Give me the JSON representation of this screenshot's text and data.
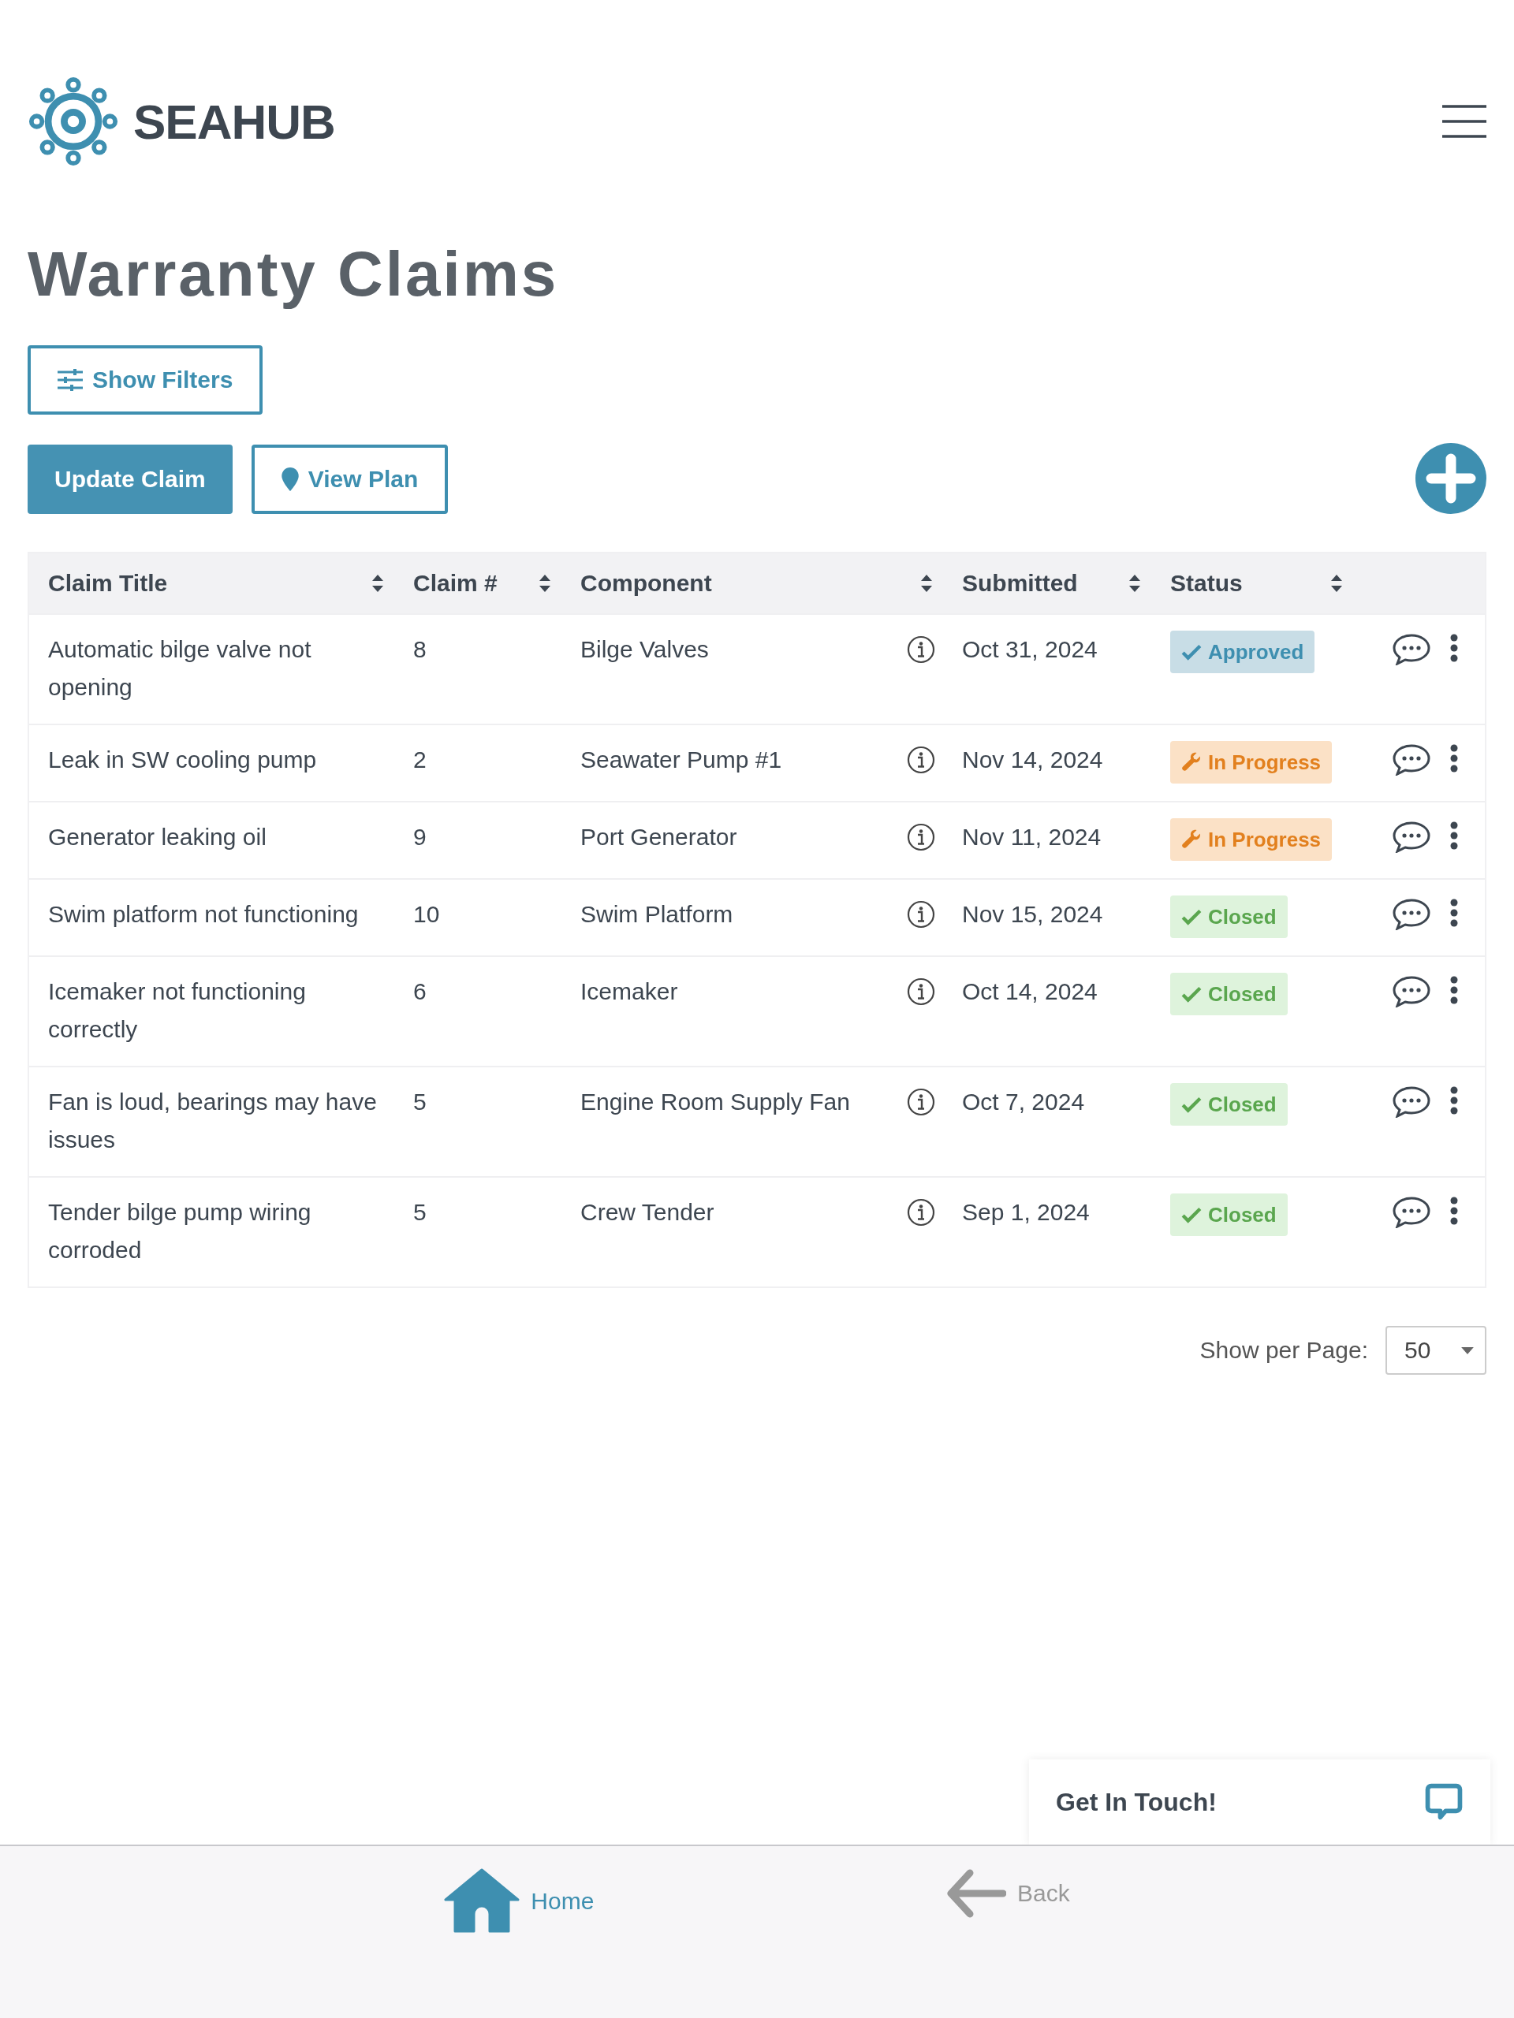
{
  "brand": {
    "name": "SEAHUB"
  },
  "page_title": "Warranty Claims",
  "filters_button": "Show Filters",
  "actions": [
    {
      "label": "Update Claim",
      "kind": "primary"
    },
    {
      "label": "View Plan",
      "kind": "outline"
    }
  ],
  "table": {
    "columns": [
      {
        "label": "Claim Title",
        "sortable": true
      },
      {
        "label": "Claim #",
        "sortable": true
      },
      {
        "label": "Component",
        "sortable": true
      },
      {
        "label": "Submitted",
        "sortable": true
      },
      {
        "label": "Status",
        "sortable": true
      }
    ],
    "rows": [
      {
        "title": "Automatic bilge valve not opening",
        "number": "8",
        "component": "Bilge Valves",
        "submitted": "Oct 31, 2024",
        "status": {
          "label": "Approved",
          "kind": "approved"
        }
      },
      {
        "title": "Leak in SW cooling pump",
        "number": "2",
        "component": "Seawater Pump #1",
        "submitted": "Nov 14, 2024",
        "status": {
          "label": "In Progress",
          "kind": "in_progress"
        }
      },
      {
        "title": "Generator leaking oil",
        "number": "9",
        "component": "Port Generator",
        "submitted": "Nov 11, 2024",
        "status": {
          "label": "In Progress",
          "kind": "in_progress"
        }
      },
      {
        "title": "Swim platform not functioning",
        "number": "10",
        "component": "Swim Platform",
        "submitted": "Nov 15, 2024",
        "status": {
          "label": "Closed",
          "kind": "closed"
        }
      },
      {
        "title": "Icemaker not functioning correctly",
        "number": "6",
        "component": "Icemaker",
        "submitted": "Oct 14, 2024",
        "status": {
          "label": "Closed",
          "kind": "closed"
        }
      },
      {
        "title": "Fan is loud, bearings may have issues",
        "number": "5",
        "component": "Engine Room Supply Fan",
        "submitted": "Oct 7, 2024",
        "status": {
          "label": "Closed",
          "kind": "closed"
        }
      },
      {
        "title": "Tender bilge pump wiring corroded",
        "number": "5",
        "component": "Crew Tender",
        "submitted": "Sep 1, 2024",
        "status": {
          "label": "Closed",
          "kind": "closed"
        }
      }
    ]
  },
  "pagination": {
    "label": "Show per Page:",
    "value": "50"
  },
  "contact": {
    "label": "Get In Touch!"
  },
  "bottom_nav": [
    {
      "label": "Home",
      "kind": "home",
      "selected": true
    },
    {
      "label": "Back",
      "kind": "back",
      "selected": false
    }
  ]
}
